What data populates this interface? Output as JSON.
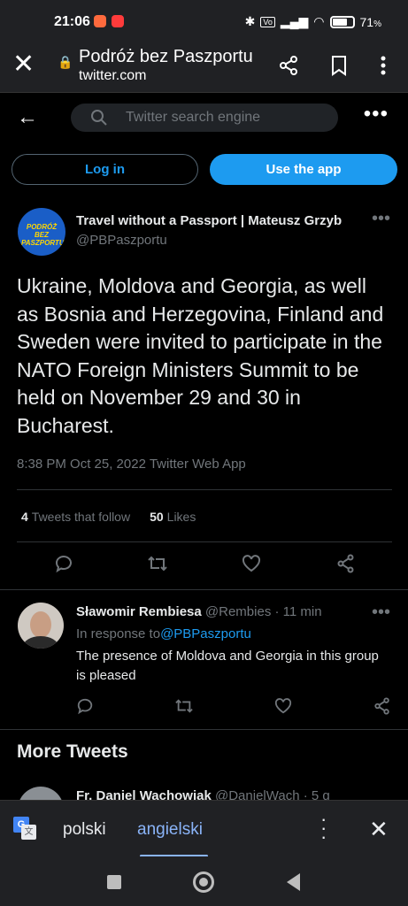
{
  "status_bar": {
    "time": "21:06",
    "battery": "71",
    "battery_unit": "%",
    "icons": [
      "bluetooth-icon",
      "volte-icon",
      "signal-icon",
      "wifi-icon",
      "battery-icon"
    ]
  },
  "browser": {
    "page_title": "Podróż bez Paszportu",
    "host": "twitter.com",
    "icons": [
      "close-icon",
      "lock-icon",
      "share-icon",
      "bookmark-icon",
      "menu-dots-icon"
    ]
  },
  "twitter_top": {
    "search_placeholder": "Twitter search engine"
  },
  "auth": {
    "login_label": "Log in",
    "use_app_label": "Use the app"
  },
  "tweet": {
    "author_name": "Travel without a Passport | Mateusz Grzyb",
    "author_handle": "@PBPaszportu",
    "avatar_text": "PODRÓŻ BEZ PASZPORTU",
    "text": "Ukraine, Moldova and Georgia, as well as Bosnia and Herzegovina, Finland and Sweden were invited to participate in the NATO Foreign Ministers Summit to be held on November 29 and 30 in Bucharest.",
    "meta": "8:38 PM Oct 25, 2022 Twitter  Web App",
    "retweets_count": "4",
    "retweets_label": "Tweets that follow",
    "likes_count": "50",
    "likes_label": "Likes"
  },
  "reply": {
    "name": "Sławomir Rembiesa",
    "handle": "@Rembies",
    "separator": "·",
    "time": "11 min",
    "in_response_prefix": "In response to",
    "in_response_handle": "@PBPaszportu",
    "text": "The presence of Moldova and Georgia in this group is pleased"
  },
  "more_tweets": {
    "heading": "More Tweets",
    "peek_name": "Fr. Daniel Wachowiak",
    "peek_handle": "@DanielWach",
    "peek_time": "· 5 g"
  },
  "translate_bar": {
    "lang_source": "polski",
    "lang_target": "angielski"
  },
  "colors": {
    "accent": "#1d9bf0",
    "muted": "#71767b",
    "translate_active": "#8ab4f8"
  }
}
